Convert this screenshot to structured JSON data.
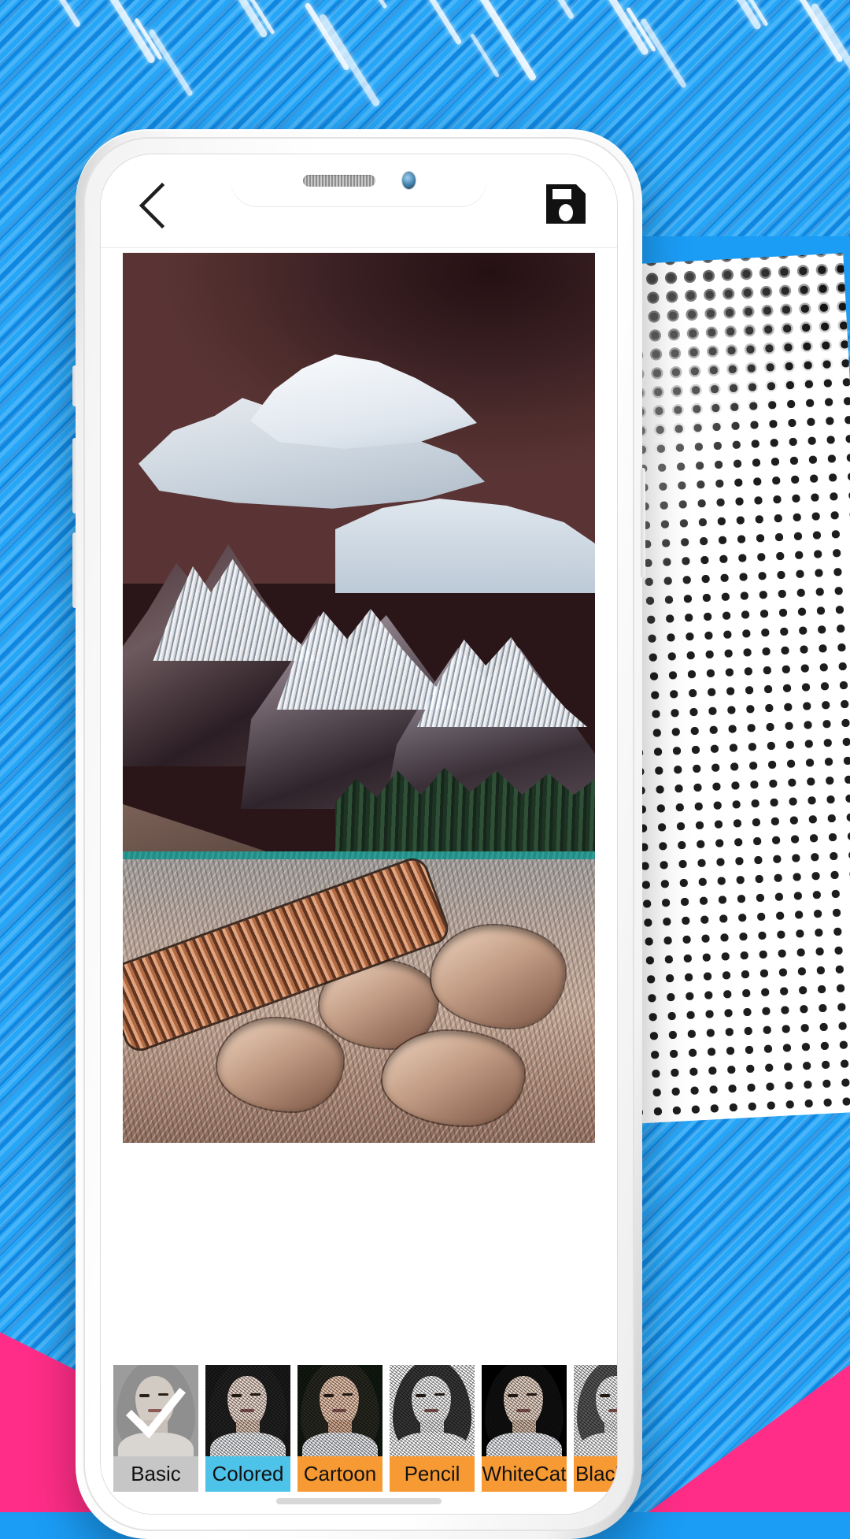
{
  "background": {
    "name": "blue-diagonal-stripes-poster",
    "blue": "#1b9cf5",
    "pink": "#ff2d87",
    "white": "#ffffff",
    "stroke_count": 22
  },
  "device": {
    "name": "white-smartphone-mockup",
    "notch": {
      "speaker": "speaker-grille",
      "camera": "front-camera"
    }
  },
  "app": {
    "appbar": {
      "back_icon": "chevron-left-icon",
      "back_label": "Back",
      "save_icon": "floppy-disk-save-icon",
      "save_label": "Save"
    },
    "photo": {
      "name": "edited-photo-preview",
      "alt": "Stylized mountain lake with fallen log and rocky shore"
    },
    "filters": {
      "selected_index": 0,
      "items": [
        {
          "label": "Basic",
          "state": "selected",
          "label_color": "#c6c6c6",
          "thumb_style": "gray-overlay",
          "check_icon": "checkmark-icon"
        },
        {
          "label": "Colored",
          "state": "normal",
          "label_color": "#4ec3ea",
          "thumb_style": "colored-sketch"
        },
        {
          "label": "Cartoon",
          "state": "normal",
          "label_color": "#f79a34",
          "thumb_style": "cartoon"
        },
        {
          "label": "Pencil",
          "state": "normal",
          "label_color": "#f79a34",
          "thumb_style": "pencil"
        },
        {
          "label": "WhiteCat",
          "state": "normal",
          "label_color": "#f79a34",
          "thumb_style": "white-on-black"
        },
        {
          "label": "BlackCat",
          "state": "normal",
          "label_color": "#f79a34",
          "thumb_style": "black-on-white"
        }
      ]
    }
  }
}
